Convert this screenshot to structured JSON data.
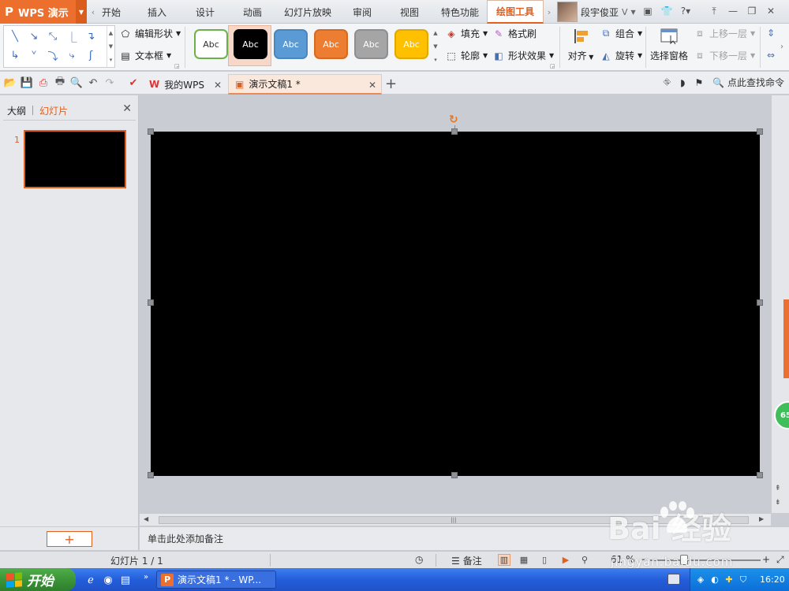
{
  "app": {
    "name": "WPS 演示",
    "accent_color": "#ec6f2d"
  },
  "ribbon_tabs": [
    {
      "label": "开始"
    },
    {
      "label": "插入"
    },
    {
      "label": "设计"
    },
    {
      "label": "动画"
    },
    {
      "label": "幻灯片放映"
    },
    {
      "label": "审阅"
    },
    {
      "label": "视图"
    },
    {
      "label": "特色功能"
    },
    {
      "label": "绘图工具",
      "active": true
    }
  ],
  "user": {
    "name": "段宇俊亚",
    "badge": "V"
  },
  "ribbon": {
    "edit_shape": "编辑形状",
    "text_box": "文本框",
    "shape_styles": [
      {
        "label": "Abc",
        "bg": "#ffffff",
        "fg": "#333333",
        "border": "#6cb24a"
      },
      {
        "label": "Abc",
        "bg": "#000000",
        "fg": "#ffffff",
        "border": "#000000"
      },
      {
        "label": "Abc",
        "bg": "#5b9bd5",
        "fg": "#ffffff",
        "border": "#4a86bf"
      },
      {
        "label": "Abc",
        "bg": "#ed7d31",
        "fg": "#ffffff",
        "border": "#d66a20"
      },
      {
        "label": "Abc",
        "bg": "#a5a5a5",
        "fg": "#ffffff",
        "border": "#8f8f8f"
      },
      {
        "label": "Abc",
        "bg": "#ffc000",
        "fg": "#ffffff",
        "border": "#e0a800"
      }
    ],
    "fill": "填充",
    "format_painter": "格式刷",
    "outline": "轮廓",
    "shape_effects": "形状效果",
    "align": "对齐",
    "group": "组合",
    "rotate": "旋转",
    "selection_pane": "选择窗格",
    "bring_forward": "上移一层",
    "send_backward": "下移一层"
  },
  "quick_toolbar": {
    "tabs": [
      {
        "label": "我的WPS",
        "active": false
      },
      {
        "label": "演示文稿1 *",
        "active": true
      }
    ],
    "search_label": "点此查找命令"
  },
  "left_panel": {
    "tab_outline": "大纲",
    "tab_slides": "幻灯片",
    "slide_number": "1",
    "add_slide": "+"
  },
  "notes": {
    "placeholder": "单击此处添加备注"
  },
  "status_bar": {
    "slide_info": "幻灯片 1 / 1",
    "notes_label": "备注",
    "zoom": "61 %"
  },
  "badge": {
    "value": "65"
  },
  "taskbar": {
    "start_label": "开始",
    "task_item": "演示文稿1 * - WP...",
    "clock": "16:20"
  },
  "watermark": {
    "logo": "Bai  经验",
    "url": "jingyan.baidu.com"
  }
}
